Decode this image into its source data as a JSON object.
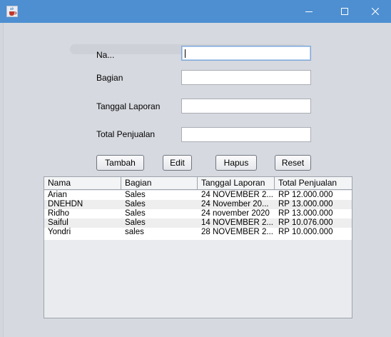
{
  "window": {
    "icon": "java-cup-icon",
    "controls": {
      "minimize": "—",
      "maximize": "☐",
      "close": "✕"
    }
  },
  "form": {
    "nama_label": "Na...",
    "bagian_label": "Bagian",
    "tanggal_label": "Tanggal Laporan",
    "total_label": "Total Penjualan",
    "nama_value": "",
    "bagian_value": "",
    "tanggal_value": "",
    "total_value": ""
  },
  "buttons": {
    "tambah": "Tambah",
    "edit": "Edit",
    "hapus": "Hapus",
    "reset": "Reset"
  },
  "table": {
    "columns": [
      "Nama",
      "Bagian",
      "Tanggal Laporan",
      "Total Penjualan"
    ],
    "rows": [
      [
        "Arian",
        "Sales",
        "24 NOVEMBER 2...",
        "RP 12.000.000"
      ],
      [
        "DNEHDN",
        "Sales",
        "24 November 20...",
        "RP 13.000.000"
      ],
      [
        "Ridho",
        "Sales",
        "24 november 2020",
        "RP 13.000.000"
      ],
      [
        "Saiful",
        "Sales",
        "14 NOVEMBER 2...",
        "RP 10.076.000"
      ],
      [
        "Yondri",
        "sales",
        "28 NOVEMBER 2...",
        "RP 10.000.000"
      ]
    ]
  },
  "colors": {
    "titlebar": "#4d8fd1",
    "background": "#d6d9df",
    "stripe": "#eeeeef"
  }
}
